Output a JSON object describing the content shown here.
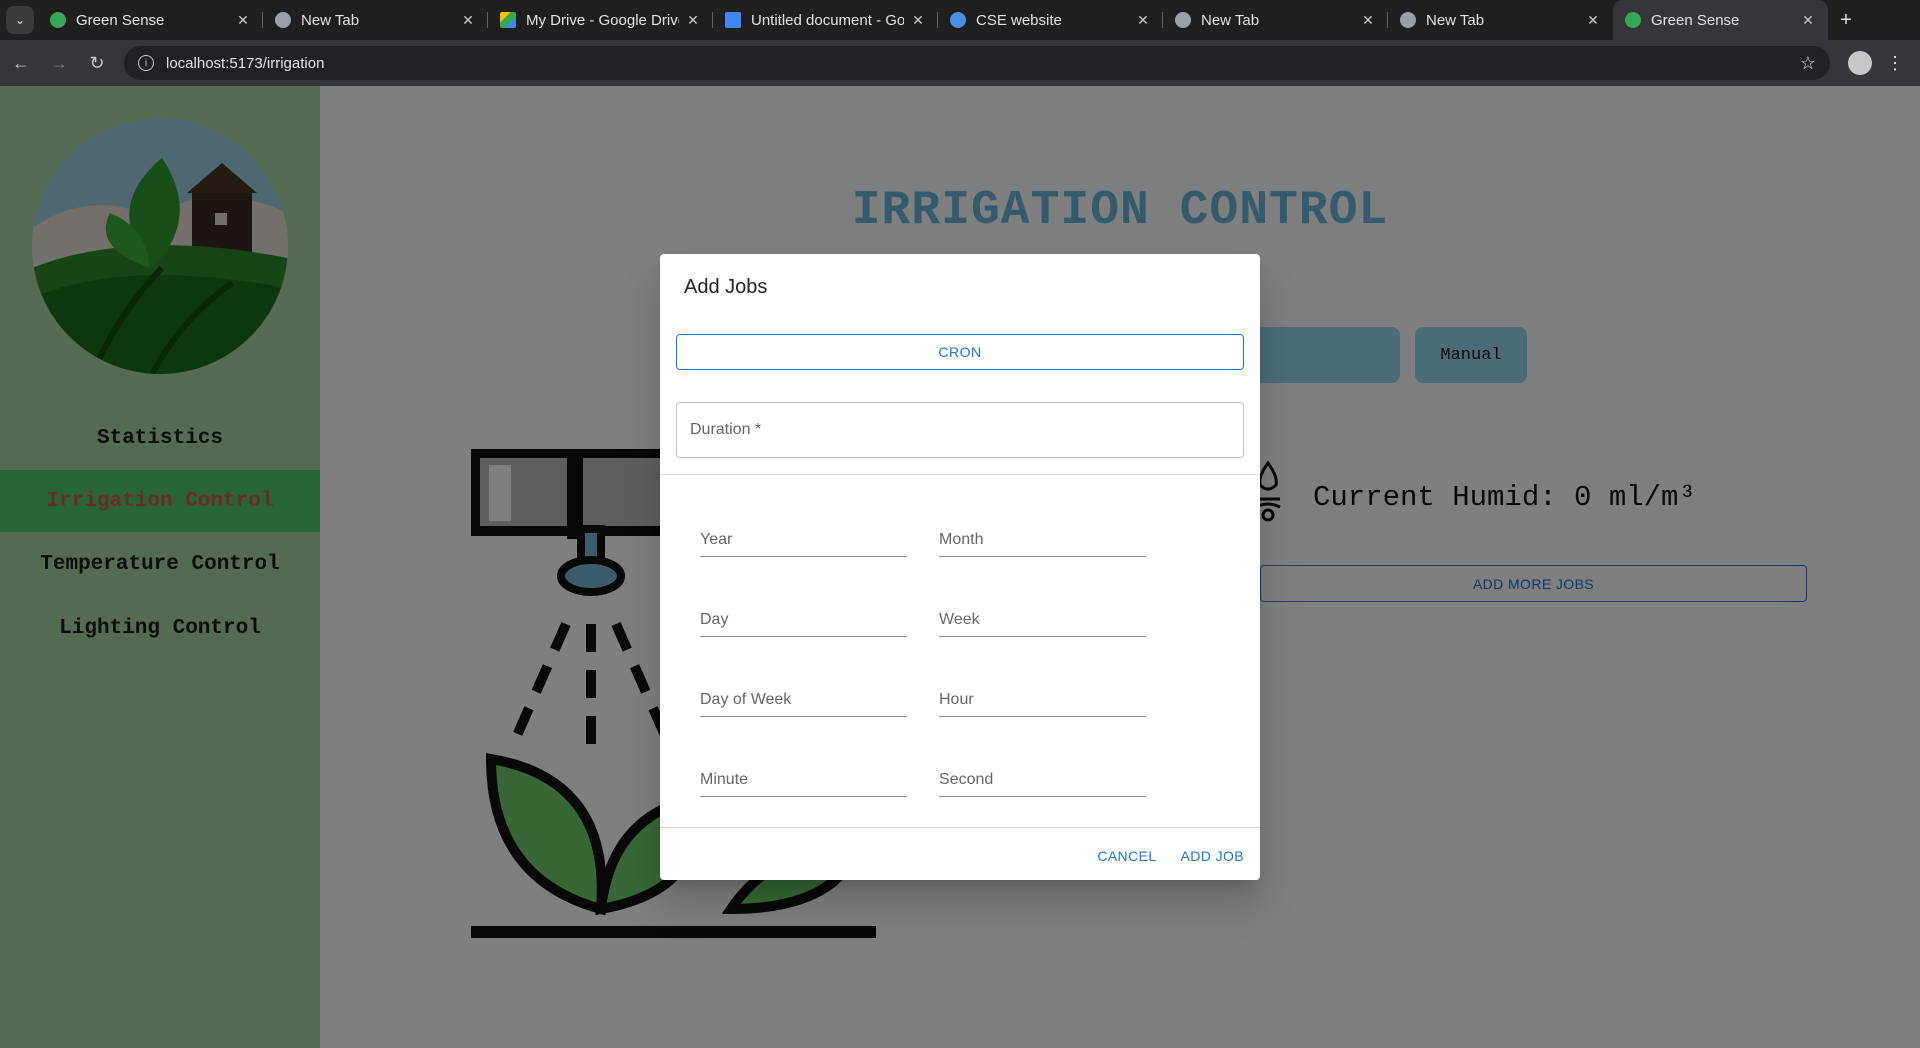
{
  "browser": {
    "tabs": [
      {
        "title": "Green Sense",
        "icon": "chrome-icon",
        "active": false
      },
      {
        "title": "New Tab",
        "icon": "chrome-icon",
        "active": false
      },
      {
        "title": "My Drive - Google Drive",
        "icon": "drive-icon",
        "active": false
      },
      {
        "title": "Untitled document - Google Docs",
        "icon": "docs-icon",
        "active": false
      },
      {
        "title": "CSE website",
        "icon": "site-icon",
        "active": false
      },
      {
        "title": "New Tab",
        "icon": "chrome-icon",
        "active": false
      },
      {
        "title": "New Tab",
        "icon": "chrome-icon",
        "active": false
      },
      {
        "title": "Green Sense",
        "icon": "chrome-icon",
        "active": true
      }
    ],
    "url": "localhost:5173/irrigation"
  },
  "sidebar": {
    "items": [
      {
        "label": "Statistics",
        "active": false
      },
      {
        "label": "Irrigation Control",
        "active": true
      },
      {
        "label": "Temperature Control",
        "active": false
      },
      {
        "label": "Lighting Control",
        "active": false
      }
    ]
  },
  "main": {
    "title": "IRRIGATION CONTROL",
    "manual_label": "Manual",
    "humid_text": "Current Humid: 0 ml/m³",
    "add_more_label": "ADD MORE JOBS"
  },
  "dialog": {
    "title": "Add Jobs",
    "cron_label": "CRON",
    "duration_label": "Duration *",
    "fields": [
      "Year",
      "Month",
      "Day",
      "Week",
      "Day of Week",
      "Hour",
      "Minute",
      "Second"
    ],
    "cancel_label": "CANCEL",
    "add_label": "ADD JOB"
  },
  "colors": {
    "sidebar": "#a8d5a5",
    "active_nav": "#4ec96e",
    "title": "#68b5d9",
    "accent": "#1976d2"
  }
}
